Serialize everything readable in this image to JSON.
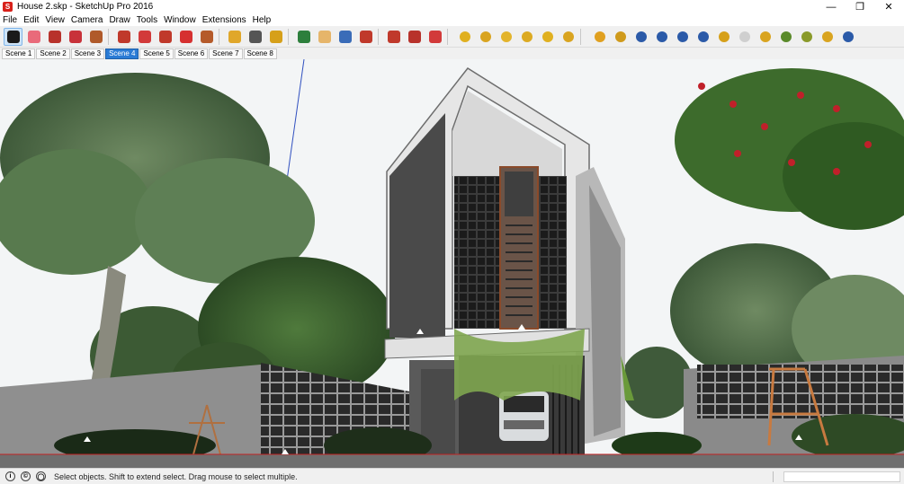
{
  "window": {
    "title": "House 2.skp - SketchUp Pro 2016",
    "logo_letter": "S",
    "minimize": "—",
    "restore": "❐",
    "close": "✕"
  },
  "menu": [
    "File",
    "Edit",
    "View",
    "Camera",
    "Draw",
    "Tools",
    "Window",
    "Extensions",
    "Help"
  ],
  "toolbar": {
    "tools": [
      {
        "name": "select-tool-button",
        "icon": "arrow-cursor-icon",
        "color": "#1a1a1a",
        "active": true
      },
      {
        "name": "eraser-tool-button",
        "icon": "eraser-icon",
        "color": "#e96a7a"
      },
      {
        "name": "line-tool-button",
        "icon": "pencil-icon",
        "color": "#b8322b"
      },
      {
        "name": "arc-tool-button",
        "icon": "arc-icon",
        "color": "#c8323a"
      },
      {
        "name": "shape-tool-button",
        "icon": "rectangle-icon",
        "color": "#b05a2a"
      },
      {
        "name": "push-pull-tool-button",
        "icon": "push-pull-icon",
        "color": "#c0392b"
      },
      {
        "name": "follow-me-tool-button",
        "icon": "follow-me-icon",
        "color": "#d23a3a"
      },
      {
        "name": "move-tool-button",
        "icon": "move-arrows-icon",
        "color": "#c0392b"
      },
      {
        "name": "rotate-tool-button",
        "icon": "rotate-icon",
        "color": "#d63030"
      },
      {
        "name": "scale-tool-button",
        "icon": "scale-icon",
        "color": "#b55a2a"
      },
      {
        "name": "tape-measure-tool-button",
        "icon": "tape-measure-icon",
        "color": "#e0a72a"
      },
      {
        "name": "text-tool-button",
        "icon": "text-icon",
        "color": "#555555"
      },
      {
        "name": "paint-bucket-tool-button",
        "icon": "paint-bucket-icon",
        "color": "#d6a01a"
      },
      {
        "name": "orbit-tool-button",
        "icon": "orbit-icon",
        "color": "#2d7f3c"
      },
      {
        "name": "pan-tool-button",
        "icon": "hand-icon",
        "color": "#e6b56a"
      },
      {
        "name": "zoom-tool-button",
        "icon": "magnifier-icon",
        "color": "#3a6cb8"
      },
      {
        "name": "zoom-extents-tool-button",
        "icon": "zoom-extents-icon",
        "color": "#c0392b"
      },
      {
        "name": "warehouse-button",
        "icon": "warehouse-icon",
        "color": "#c0392b"
      },
      {
        "name": "extension-warehouse-button",
        "icon": "extension-icon",
        "color": "#b8322b"
      },
      {
        "name": "send-to-layout-button",
        "icon": "layout-icon",
        "color": "#d23a3a"
      },
      {
        "name": "plugin-tool-1-button",
        "icon": "yellow-ball-icon",
        "color": "#e0b020"
      },
      {
        "name": "plugin-tool-2-button",
        "icon": "lamp-icon",
        "color": "#d9a420"
      },
      {
        "name": "plugin-tool-3-button",
        "icon": "flag-icon",
        "color": "#e3b42c"
      },
      {
        "name": "plugin-tool-4-button",
        "icon": "light-icon",
        "color": "#dcaa22"
      },
      {
        "name": "plugin-tool-5-button",
        "icon": "sphere-icon",
        "color": "#e0b020"
      },
      {
        "name": "plugin-tool-6-button",
        "icon": "spot-light-icon",
        "color": "#d9a420"
      },
      {
        "name": "render-tool-1-button",
        "icon": "material-icon",
        "color": "#e0a020"
      },
      {
        "name": "render-tool-2-button",
        "icon": "tag-icon",
        "color": "#cf9a1c"
      },
      {
        "name": "render-tool-3-button",
        "icon": "render-icon",
        "color": "#2b5aa8"
      },
      {
        "name": "render-tool-4-button",
        "icon": "rt-icon",
        "color": "#2b5aa8"
      },
      {
        "name": "render-tool-5-button",
        "icon": "batch-icon",
        "color": "#2b5aa8"
      },
      {
        "name": "render-tool-6-button",
        "icon": "help-icon",
        "color": "#2b5aa8"
      },
      {
        "name": "render-tool-7-button",
        "icon": "tag2-icon",
        "color": "#d6a01a"
      },
      {
        "name": "render-tool-8-button",
        "icon": "sphere-white-icon",
        "color": "#cfcfcf"
      },
      {
        "name": "render-tool-9-button",
        "icon": "plane-icon",
        "color": "#d9a420"
      },
      {
        "name": "render-tool-10-button",
        "icon": "tree-icon",
        "color": "#5a8a2a"
      },
      {
        "name": "render-tool-11-button",
        "icon": "tree2-icon",
        "color": "#8a9a2a"
      },
      {
        "name": "render-tool-12-button",
        "icon": "sun-icon",
        "color": "#d9a420"
      },
      {
        "name": "render-tool-13-button",
        "icon": "info-icon",
        "color": "#2b5aa8"
      }
    ]
  },
  "scenes": [
    {
      "label": "Scene 1",
      "active": false
    },
    {
      "label": "Scene 2",
      "active": false
    },
    {
      "label": "Scene 3",
      "active": false
    },
    {
      "label": "Scene 4",
      "active": true
    },
    {
      "label": "Scene 5",
      "active": false
    },
    {
      "label": "Scene 6",
      "active": false
    },
    {
      "label": "Scene 7",
      "active": false
    },
    {
      "label": "Scene 8",
      "active": false
    }
  ],
  "status": {
    "geo_icon": "geo-location-icon",
    "credits_icon": "credits-icon",
    "user_icon": "user-icon",
    "text": "Select objects. Shift to extend select. Drag mouse to select multiple.",
    "measurements_value": ""
  }
}
